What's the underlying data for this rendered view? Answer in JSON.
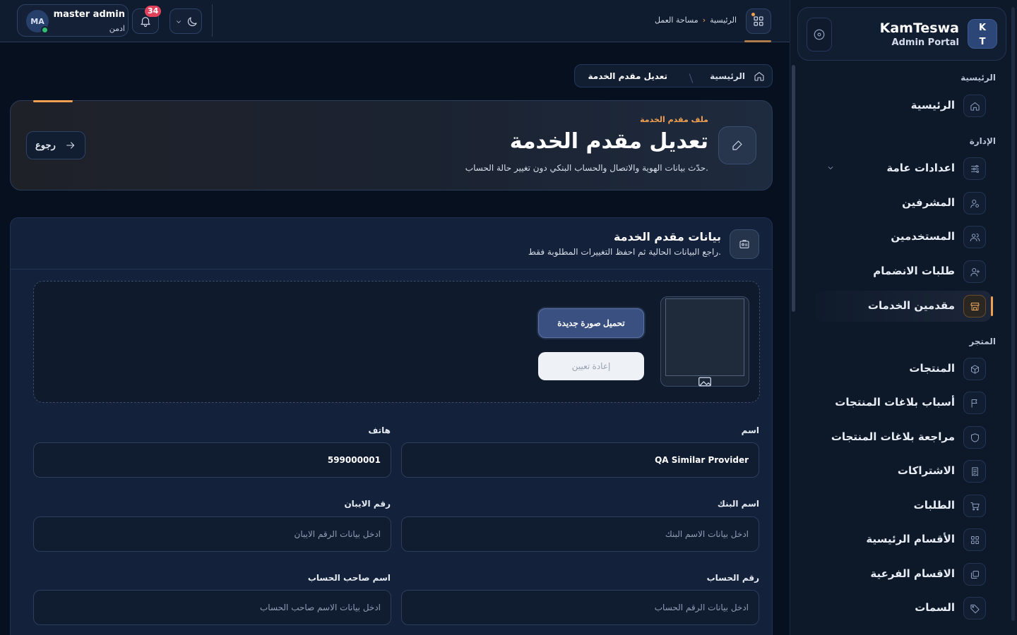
{
  "brand": {
    "logo_line1": "K",
    "logo_line2": "T",
    "name": "KamTeswa",
    "subtitle": "Admin Portal"
  },
  "sidebar": {
    "sections": [
      {
        "title": "الرئيسية",
        "items": [
          {
            "label": "الرئيسية",
            "icon": "home-icon"
          }
        ]
      },
      {
        "title": "الإدارة",
        "items": [
          {
            "label": "اعدادات عامة",
            "icon": "sliders-icon",
            "has_submenu": true
          },
          {
            "label": "المشرفين",
            "icon": "user-gear-icon"
          },
          {
            "label": "المستخدمين",
            "icon": "users-icon"
          },
          {
            "label": "طلبات الانضمام",
            "icon": "user-plus-icon"
          },
          {
            "label": "مقدمين الخدمات",
            "icon": "store-icon",
            "active": true
          }
        ]
      },
      {
        "title": "المتجر",
        "items": [
          {
            "label": "المنتجات",
            "icon": "box-icon"
          },
          {
            "label": "أسباب بلاغات المنتجات",
            "icon": "flag-icon"
          },
          {
            "label": "مراجعة بلاغات المنتجات",
            "icon": "shield-icon"
          },
          {
            "label": "الاشتراكات",
            "icon": "receipt-icon"
          },
          {
            "label": "الطلبات",
            "icon": "cart-icon"
          },
          {
            "label": "الأقسام الرئيسية",
            "icon": "grid-icon"
          },
          {
            "label": "الاقسام الفرعية",
            "icon": "layers-icon"
          },
          {
            "label": "السمات",
            "icon": "tag-icon"
          }
        ]
      }
    ]
  },
  "topbar": {
    "user": {
      "initials": "MA",
      "name": "master admin",
      "role": "ادمن",
      "status_color": "#2fbf71"
    },
    "notifications_count": "34",
    "breadcrumb": {
      "home": "الرئيسية",
      "current": "مساحة العمل"
    }
  },
  "page": {
    "breadcrumb": {
      "home": "الرئيسية",
      "current": "تعديل مقدم الخدمة"
    },
    "hero": {
      "kicker": "ملف مقدم الخدمة",
      "title": "تعديل مقدم الخدمة",
      "description": "حدّث بيانات الهوية والاتصال والحساب البنكي دون تغيير حالة الحساب.",
      "back_label": "رجوع"
    },
    "form": {
      "title": "بيانات مقدم الخدمة",
      "subtitle": "راجع البيانات الحالية ثم احفظ التغييرات المطلوبة فقط.",
      "upload_label": "تحميل صورة جديدة",
      "reset_label": "إعادة تعيين",
      "fields": {
        "name": {
          "label": "اسم",
          "value": "QA Similar Provider"
        },
        "phone": {
          "label": "هاتف",
          "value": "599000001"
        },
        "bank_name": {
          "label": "اسم البنك",
          "placeholder": "ادخل بيانات الاسم البنك"
        },
        "iban": {
          "label": "رقم الايبان",
          "placeholder": "ادخل بيانات الرقم الايبان"
        },
        "account_number": {
          "label": "رقم الحساب",
          "placeholder": "ادخل بيانات الرقم الحساب"
        },
        "account_holder": {
          "label": "اسم صاحب الحساب",
          "placeholder": "ادخل بيانات الاسم صاحب الحساب"
        }
      }
    }
  },
  "colors": {
    "accent": "#f0a050",
    "background": "#07101f",
    "panel": "#13223a",
    "badge": "#e0415b"
  }
}
